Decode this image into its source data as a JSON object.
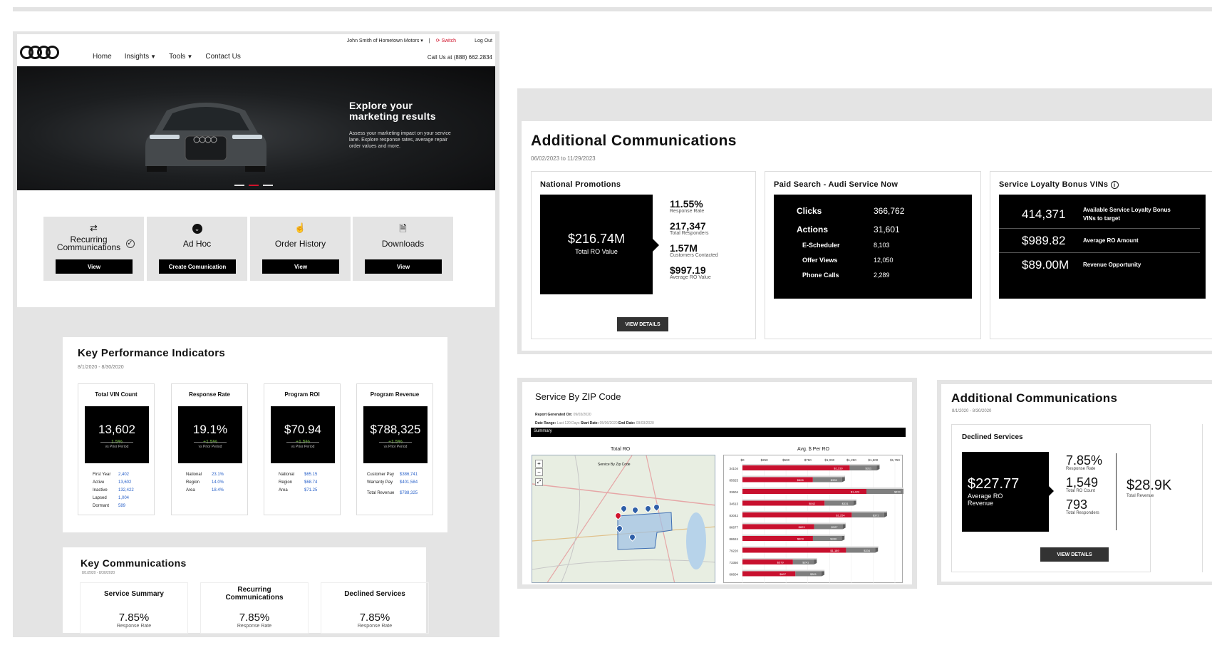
{
  "site": {
    "nav": [
      "Home",
      "Insights",
      "Tools",
      "Contact Us"
    ],
    "user": "John Smith of Hometown Motors",
    "switch": "Switch",
    "logout": "Log Out",
    "phone": "Call Us at (888) 662.2834",
    "hero_title_1": "Explore your",
    "hero_title_2": "marketing results",
    "hero_text": "Assess your marketing impact on your service lane. Explore response rates, average repair order values and more.",
    "tiles": [
      {
        "title": "Recurring Communications",
        "button": "View",
        "icon": "repeat-icon"
      },
      {
        "title": "Ad Hoc",
        "button": "Create Comunication",
        "icon": "chevron-circle-icon"
      },
      {
        "title": "Order History",
        "button": "View",
        "icon": "pointer-icon"
      },
      {
        "title": "Downloads",
        "button": "View",
        "icon": "document-icon"
      }
    ]
  },
  "kpi": {
    "title": "Key Performance Indicators",
    "dates": "8/1/2020 - 8/30/2020",
    "cards": [
      {
        "title": "Total VIN Count",
        "value": "13,602",
        "delta": "1.5%",
        "period": "vs Prior Period",
        "rows": [
          [
            "First Year",
            "2,402"
          ],
          [
            "Active",
            "13,602"
          ],
          [
            "Inactive",
            "132,422"
          ],
          [
            "Lapsed",
            "1,004"
          ],
          [
            "Dormant",
            "589"
          ]
        ]
      },
      {
        "title": "Response Rate",
        "value": "19.1%",
        "delta": "+1.5%",
        "period": "vs Prior Period",
        "rows": [
          [
            "National",
            "23.1%"
          ],
          [
            "Region",
            "14.0%"
          ],
          [
            "Area",
            "18.4%"
          ]
        ]
      },
      {
        "title": "Program ROI",
        "value": "$70.94",
        "delta": "+1.5%",
        "period": "vs Prior Period",
        "rows": [
          [
            "National",
            "$65.15"
          ],
          [
            "Region",
            "$68.74"
          ],
          [
            "Area",
            "$71.25"
          ]
        ]
      },
      {
        "title": "Program Revenue",
        "value": "$788,325",
        "delta": "+1.5%",
        "period": "vs Prior Period",
        "rows": [
          [
            "Customer Pay",
            "$386,741"
          ],
          [
            "Warranty Pay",
            "$401,584"
          ],
          [
            "Total Revenue",
            "$788,325"
          ]
        ]
      }
    ]
  },
  "kc": {
    "title": "Key Communications",
    "dates": "8/1/2020 - 8/30/2020",
    "cards": [
      {
        "title": "Service Summary",
        "value": "7.85%",
        "label": "Response Rate"
      },
      {
        "title": "Recurring Communications",
        "value": "7.85%",
        "label": "Response Rate"
      },
      {
        "title": "Declined Services",
        "value": "7.85%",
        "label": "Response Rate"
      }
    ]
  },
  "ac": {
    "title": "Additional Communications",
    "dates": "06/02/2023 to 11/29/2023",
    "np": {
      "title": "National Promotions",
      "value": "$216.74M",
      "label": "Total RO Value",
      "metrics": [
        {
          "v": "11.55%",
          "l": "Response Rate"
        },
        {
          "v": "217,347",
          "l": "Total Responders"
        },
        {
          "v": "1.57M",
          "l": "Customers Contacted"
        },
        {
          "v": "$997.19",
          "l": "Average RO Value"
        }
      ],
      "button": "VIEW DETAILS"
    },
    "ps": {
      "title": "Paid Search - Audi Service Now",
      "rows": [
        [
          "Clicks",
          "366,762"
        ],
        [
          "Actions",
          "31,601"
        ],
        [
          "E-Scheduler",
          "8,103"
        ],
        [
          "Offer Views",
          "12,050"
        ],
        [
          "Phone Calls",
          "2,289"
        ]
      ]
    },
    "sl": {
      "title": "Service Loyalty Bonus VINs",
      "rows": [
        [
          "414,371",
          "Available Service Loyalty Bonus VINs to target"
        ],
        [
          "$989.82",
          "Average RO Amount"
        ],
        [
          "$89.00M",
          "Revenue Opportunity"
        ]
      ]
    }
  },
  "zip": {
    "title": "Service By ZIP Code",
    "generated_label": "Report Generated On:",
    "generated": "09/03/2020",
    "range_label": "Date Range:",
    "range": "Last 120 Days",
    "start_label": "Start Date:",
    "start": "05/06/2020",
    "end_label": "End Date:",
    "end": "09/03/2020",
    "summary": "Summary",
    "map_title": "Total RO",
    "map_sub": "Service By Zip Code",
    "chart_title": "Avg. $ Per RO"
  },
  "chart_data": {
    "type": "bar",
    "title": "Avg. $ Per RO",
    "xticks": [
      "$0",
      "$250",
      "$500",
      "$750",
      "$1,000",
      "$1,250",
      "$1,500",
      "$1,750"
    ],
    "categories": [
      "34104",
      "85825",
      "33604",
      "34613",
      "83042",
      "86677",
      "88624",
      "79220",
      "73350",
      "68604"
    ],
    "series": [
      {
        "values": [
          1230,
          808,
          1423,
          942,
          1254,
          823,
          809,
          1189,
          579,
          607
        ]
      },
      {
        "values": [
          311,
          335,
          450,
          331,
          372,
          327,
          330,
          334,
          241,
          301
        ]
      }
    ],
    "xlim": [
      0,
      1750
    ]
  },
  "ac2": {
    "title": "Additional Communications",
    "dates": "8/1/2020 - 8/30/2020",
    "card_title": "Declined Services",
    "value": "$227.77",
    "label": "Average RO Revenue",
    "metrics": [
      {
        "v": "7.85%",
        "l": "Response Rate"
      },
      {
        "v": "1,549",
        "l": "Total RO Count"
      },
      {
        "v": "793",
        "l": "Total Responders"
      }
    ],
    "revenue": {
      "v": "$28.9K",
      "l": "Total Revenue"
    },
    "button": "VIEW DETAILS"
  }
}
